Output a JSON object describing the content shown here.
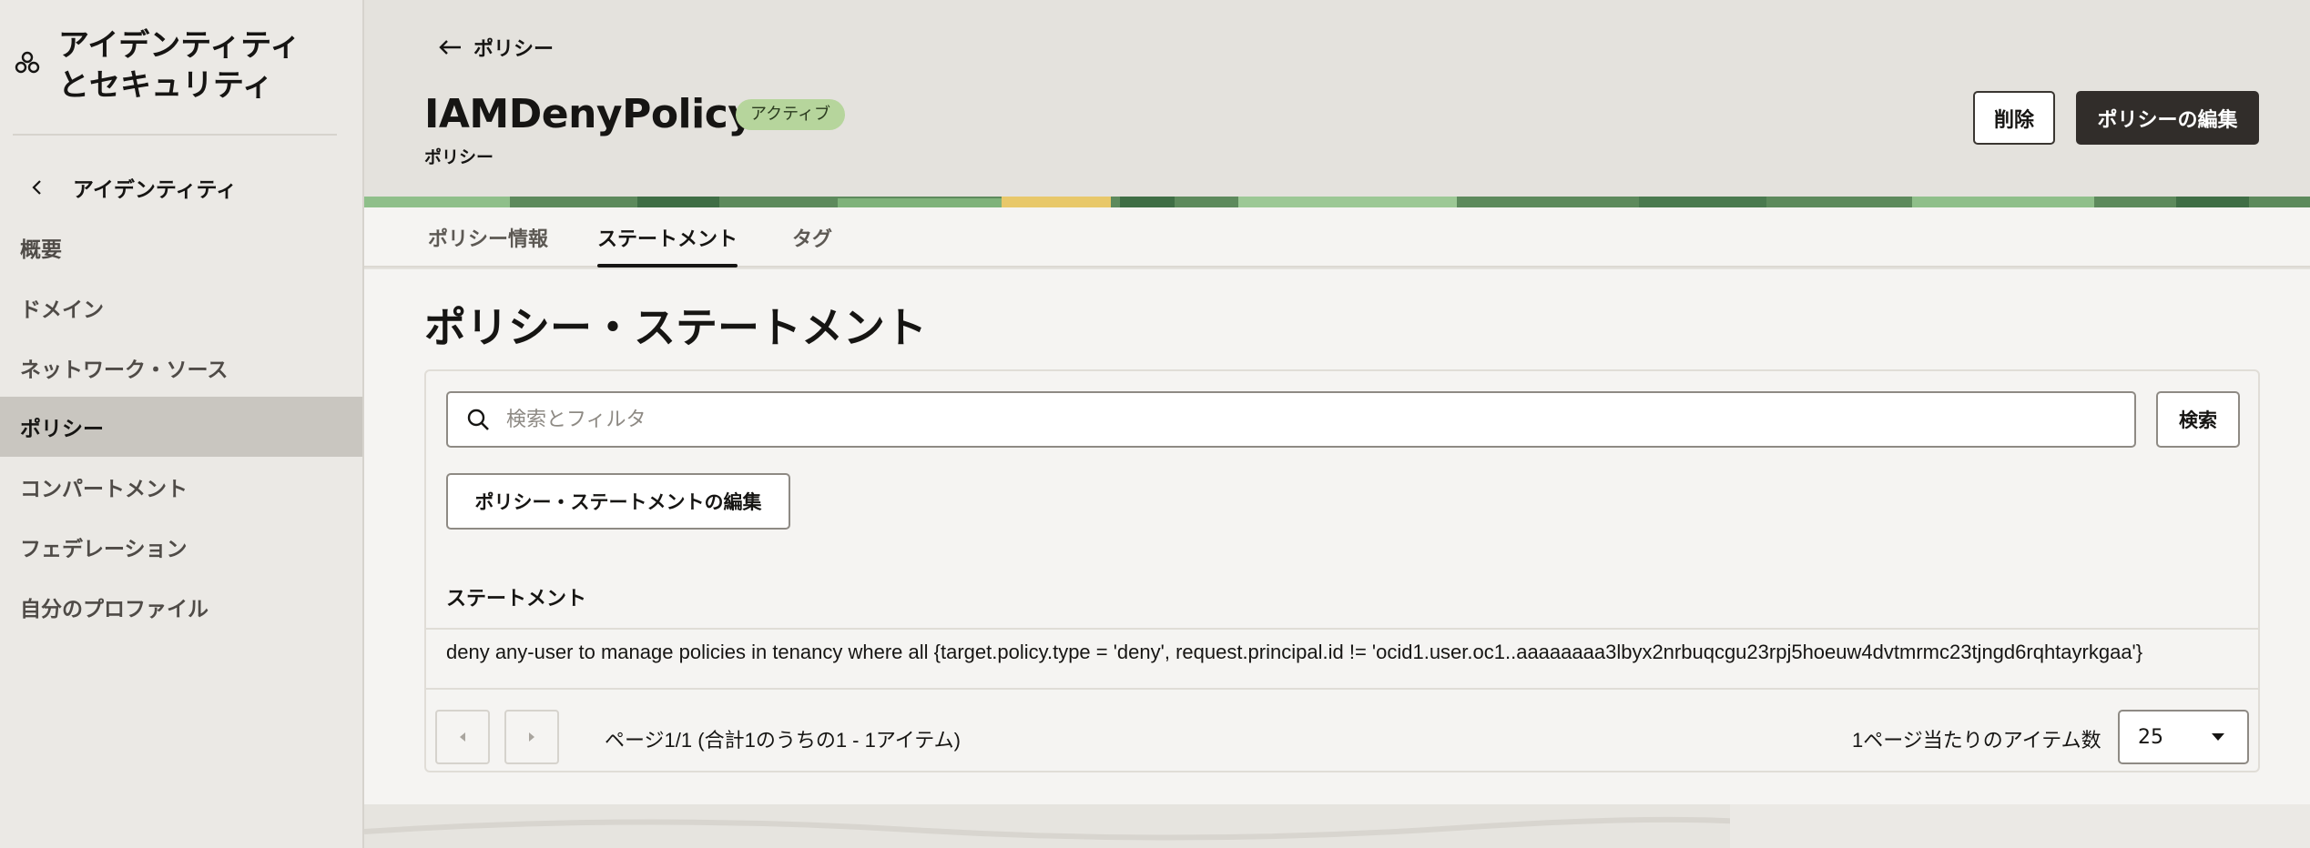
{
  "sidebar": {
    "title": "アイデンティティとセキュリティ",
    "back_label": "アイデンティティ",
    "items": [
      {
        "label": "概要"
      },
      {
        "label": "ドメイン"
      },
      {
        "label": "ネットワーク・ソース"
      },
      {
        "label": "ポリシー"
      },
      {
        "label": "コンパートメント"
      },
      {
        "label": "フェデレーション"
      },
      {
        "label": "自分のプロファイル"
      }
    ],
    "active_item": "ポリシー"
  },
  "header": {
    "back_link": "ポリシー",
    "title": "IAMDenyPolicy",
    "status_badge": "アクティブ",
    "subtitle": "ポリシー",
    "delete_label": "削除",
    "edit_label": "ポリシーの編集"
  },
  "tabs": [
    {
      "label": "ポリシー情報"
    },
    {
      "label": "ステートメント"
    },
    {
      "label": "タグ"
    }
  ],
  "active_tab": "ステートメント",
  "statements": {
    "section_title": "ポリシー・ステートメント",
    "search_placeholder": "検索とフィルタ",
    "search_value": "",
    "search_button": "検索",
    "edit_button": "ポリシー・ステートメントの編集",
    "column_header": "ステートメント",
    "rows": [
      {
        "statement": "deny any-user to manage policies in tenancy where all {target.policy.type = 'deny', request.principal.id != 'ocid1.user.oc1..aaaaaaaa3lbyx2nrbuqcgu23rpj5hoeuw4dvtmrmc23tjngd6rqhtayrkgaa'}"
      }
    ],
    "pagination_text": "ページ1/1 (合計1のうちの1 - 1アイテム)",
    "per_page_label": "1ページ当たりのアイテム数",
    "per_page_value": "25"
  },
  "icons": {
    "logo": "identity-logo-icon",
    "back": "arrow-left-icon",
    "chevron": "chevron-left-icon",
    "search": "search-icon",
    "prev": "caret-left-icon",
    "next": "caret-right-icon",
    "dropdown": "caret-down-icon"
  },
  "colors": {
    "badge_bg": "#b6d59c",
    "primary_button": "#312d2a",
    "active_sidebar": "#c9c6c0"
  }
}
